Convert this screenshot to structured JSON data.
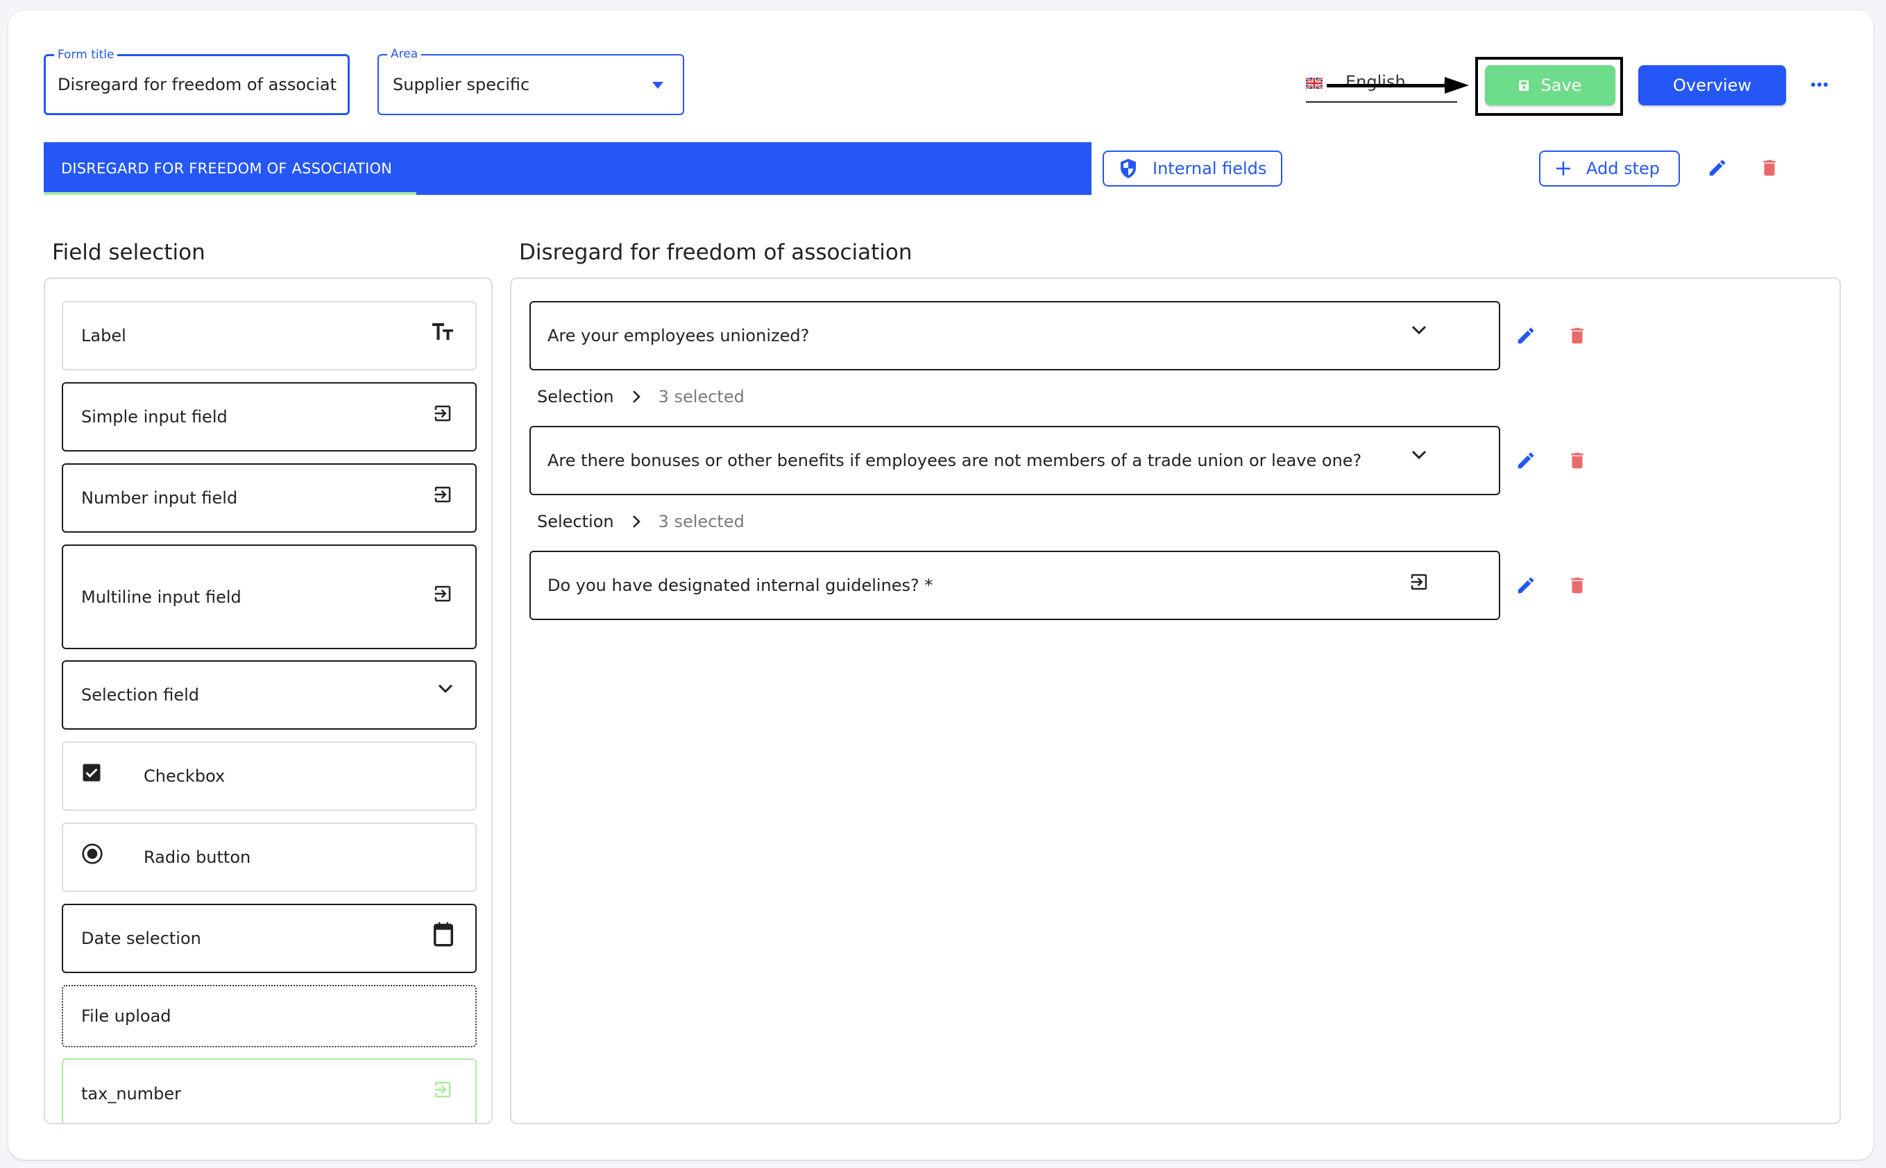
{
  "header": {
    "form_title": {
      "label": "Form title",
      "value": "Disregard for freedom of association",
      "visible_value": "lisregard for freedom of association"
    },
    "area": {
      "label": "Area",
      "value": "Supplier specific"
    },
    "language": {
      "flag_icon": "uk-flag-icon",
      "value": "English"
    },
    "save_label": "Save",
    "overview_label": "Overview",
    "more_icon": "more-horizontal-icon"
  },
  "annotation": {
    "type": "arrow-and-highlight",
    "target": "save-button"
  },
  "tabs": [
    {
      "label": "DISREGARD FOR FREEDOM OF ASSOCIATION",
      "active": true
    }
  ],
  "toolbar": {
    "internal_fields_label": "Internal fields",
    "add_step_label": "Add step",
    "edit_icon": "pencil-icon",
    "delete_icon": "trash-icon"
  },
  "field_selection": {
    "title": "Field selection",
    "items": [
      {
        "label": "Label",
        "icon": "text-size-icon"
      },
      {
        "label": "Simple input field",
        "icon": "input-icon"
      },
      {
        "label": "Number input field",
        "icon": "input-icon"
      },
      {
        "label": "Multiline input field",
        "icon": "input-icon"
      },
      {
        "label": "Selection field",
        "icon": "chevron-down-icon"
      },
      {
        "label": "Checkbox",
        "icon": "checkbox-checked-icon"
      },
      {
        "label": "Radio button",
        "icon": "radio-checked-icon"
      },
      {
        "label": "Date selection",
        "icon": "calendar-icon"
      },
      {
        "label": "File upload",
        "icon": ""
      },
      {
        "label": "tax_number",
        "icon": "input-icon"
      }
    ]
  },
  "step": {
    "title": "Disregard for freedom of association",
    "questions": [
      {
        "text": "Are your employees unionized?",
        "type": "selection",
        "icon": "chevron-down-icon",
        "selection_label": "Selection",
        "selection_count": "3 selected"
      },
      {
        "text": "Are there bonuses or other benefits if employees are not members of a trade union or leave one?",
        "type": "selection",
        "icon": "chevron-down-icon",
        "selection_label": "Selection",
        "selection_count": "3 selected"
      },
      {
        "text": "Do you have designated internal guidelines? *",
        "type": "input",
        "icon": "input-icon"
      }
    ]
  },
  "colors": {
    "primary": "#2457f5",
    "save_green": "#6ddc8b",
    "tab_underline": "#a8ec9c",
    "delete_red": "#e96a6a",
    "page_bg": "#f4f4fa"
  }
}
